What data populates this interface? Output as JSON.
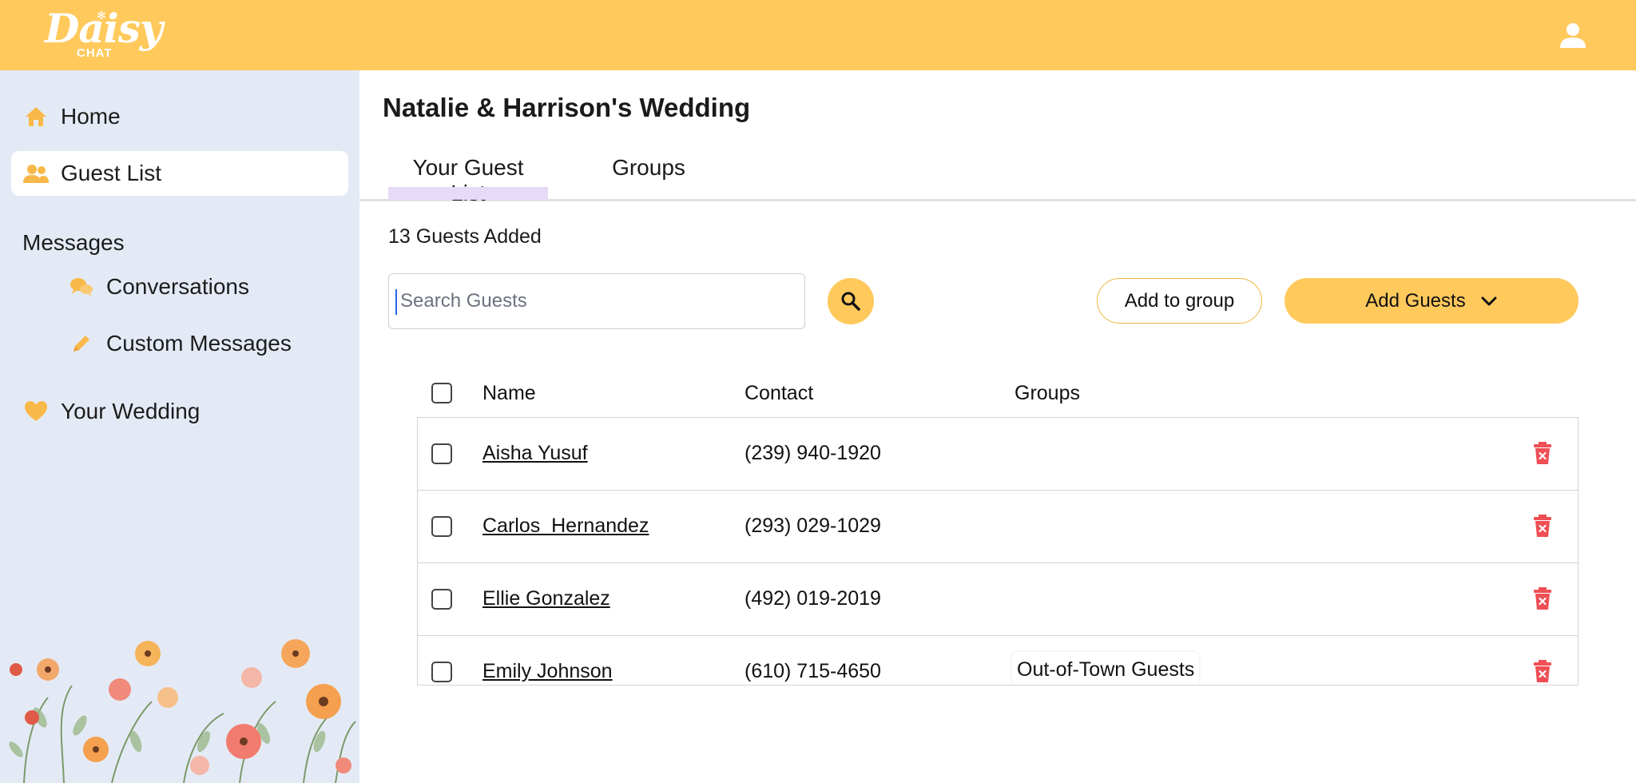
{
  "app": {
    "logo_main": "Daisy",
    "logo_sub": "CHAT",
    "brand_color": "#FFC95C"
  },
  "header": {
    "user_icon": "user-icon"
  },
  "sidebar": {
    "items": [
      {
        "label": "Home",
        "icon": "home-icon"
      },
      {
        "label": "Guest List",
        "icon": "users-icon",
        "active": true
      },
      {
        "label": "Conversations",
        "icon": "chat-bubbles-icon"
      },
      {
        "label": "Custom Messages",
        "icon": "pencil-icon"
      },
      {
        "label": "Your Wedding",
        "icon": "heart-icon"
      }
    ],
    "messages_heading": "Messages"
  },
  "main": {
    "title": "Natalie & Harrison's Wedding",
    "tabs": [
      {
        "label": "Your Guest List",
        "active": true
      },
      {
        "label": "Groups"
      }
    ],
    "guest_count": "13 Guests Added",
    "search": {
      "placeholder": "Search Guests",
      "value": ""
    },
    "add_to_group_label": "Add to group",
    "add_guests_label": "Add Guests"
  },
  "table": {
    "headers": [
      "Name",
      "Contact",
      "Groups"
    ],
    "rows": [
      {
        "name": "Aisha Yusuf",
        "contact": "(239) 940-1920",
        "groups": ""
      },
      {
        "name": "Carlos  Hernandez",
        "contact": "(293) 029-1029",
        "groups": ""
      },
      {
        "name": "Ellie Gonzalez",
        "contact": "(492) 019-2019",
        "groups": ""
      },
      {
        "name": "Emily Johnson",
        "contact": "(610) 715-4650",
        "groups": "Out-of-Town Guests"
      }
    ]
  }
}
